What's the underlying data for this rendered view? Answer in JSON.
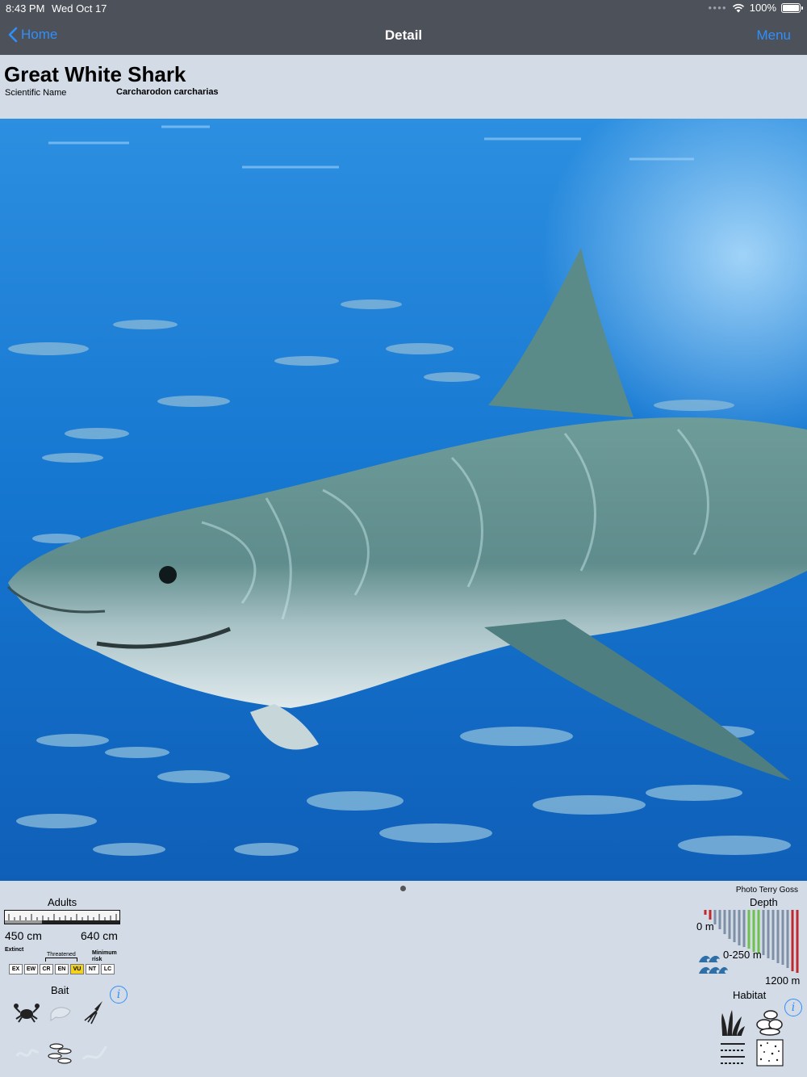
{
  "status": {
    "time": "8:43 PM",
    "date": "Wed Oct 17",
    "battery": "100%"
  },
  "nav": {
    "back_label": "Home",
    "title": "Detail",
    "menu_label": "Menu"
  },
  "species": {
    "common_name": "Great White Shark",
    "scientific_label": "Scientific Name",
    "scientific_name": "Carcharodon carcharias"
  },
  "photo": {
    "credit": "Photo Terry Goss"
  },
  "adults": {
    "label": "Adults",
    "min_size": "450 cm",
    "max_size": "640 cm"
  },
  "iucn": {
    "extinct_label": "Extinct",
    "threatened_label": "Threatened",
    "minimum_label": "Minimum risk",
    "categories": [
      "EX",
      "EW",
      "CR",
      "EN",
      "VU",
      "NT",
      "LC"
    ],
    "active": "VU",
    "active_color": "#f2d21b"
  },
  "bait": {
    "label": "Bait",
    "info_glyph": "i",
    "items": [
      {
        "icon": "crab-icon",
        "active": true
      },
      {
        "icon": "shrimp-icon",
        "active": false
      },
      {
        "icon": "squid-icon",
        "active": true
      },
      {
        "icon": "worm-icon",
        "active": false
      },
      {
        "icon": "fish-school-icon",
        "active": true
      },
      {
        "icon": "eel-icon",
        "active": false
      }
    ]
  },
  "depth": {
    "label": "Depth",
    "top": "0 m",
    "range": "0-250 m",
    "bottom": "1200 m"
  },
  "habitat": {
    "label": "Habitat",
    "info_glyph": "i",
    "items": [
      {
        "icon": "seagrass-icon"
      },
      {
        "icon": "rocks-icon"
      },
      {
        "icon": "sediment-icon"
      },
      {
        "icon": "sand-icon"
      }
    ]
  },
  "colors": {
    "nav_bg": "#4d5159",
    "accent": "#2f8ffc",
    "page_bg": "#d2dbe6"
  }
}
